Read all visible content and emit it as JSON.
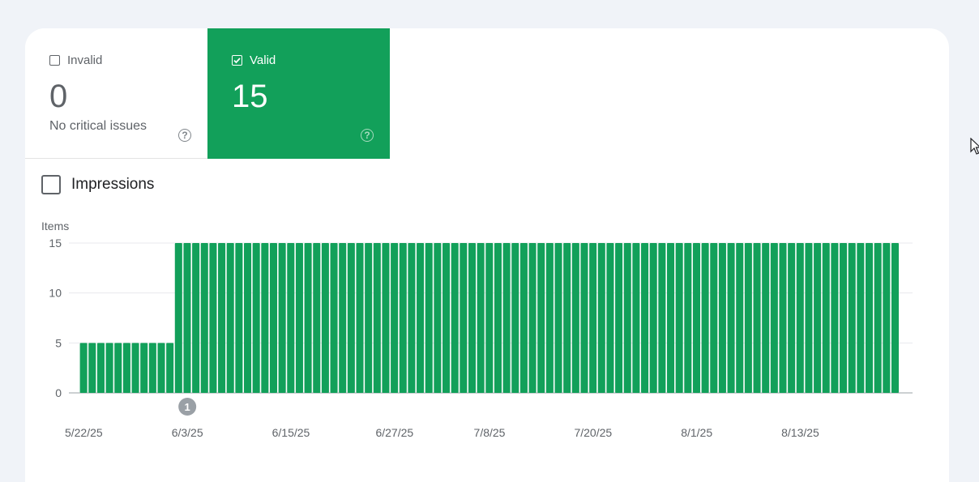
{
  "tiles": {
    "invalid": {
      "label": "Invalid",
      "value": "0",
      "subtitle": "No critical issues",
      "checked": false,
      "help_icon": "help-circle-icon"
    },
    "valid": {
      "label": "Valid",
      "value": "15",
      "checked": true,
      "help_icon": "help-circle-icon"
    }
  },
  "impressions": {
    "label": "Impressions",
    "checked": false
  },
  "colors": {
    "bar": "#12a05a",
    "valid_tile": "#12a05a",
    "annotation": "#9aa0a6"
  },
  "chart_data": {
    "type": "bar",
    "ylabel": "Items",
    "ylim": [
      0,
      15
    ],
    "yticks": [
      0,
      5,
      10,
      15
    ],
    "x_ticks": [
      "5/22/25",
      "6/3/25",
      "6/15/25",
      "6/27/25",
      "7/8/25",
      "7/20/25",
      "8/1/25",
      "8/13/25"
    ],
    "start_date": "5/22/25",
    "end_date": "8/24/25",
    "series": [
      {
        "values": [
          5,
          5,
          5,
          5,
          5,
          5,
          5,
          5,
          5,
          5,
          5,
          15,
          15,
          15,
          15,
          15,
          15,
          15,
          15,
          15,
          15,
          15,
          15,
          15,
          15,
          15,
          15,
          15,
          15,
          15,
          15,
          15,
          15,
          15,
          15,
          15,
          15,
          15,
          15,
          15,
          15,
          15,
          15,
          15,
          15,
          15,
          15,
          15,
          15,
          15,
          15,
          15,
          15,
          15,
          15,
          15,
          15,
          15,
          15,
          15,
          15,
          15,
          15,
          15,
          15,
          15,
          15,
          15,
          15,
          15,
          15,
          15,
          15,
          15,
          15,
          15,
          15,
          15,
          15,
          15,
          15,
          15,
          15,
          15,
          15,
          15,
          15,
          15,
          15,
          15,
          15,
          15,
          15,
          15,
          15
        ]
      }
    ],
    "annotations": [
      {
        "label": "1",
        "date": "6/3/25"
      }
    ],
    "grid": true
  }
}
